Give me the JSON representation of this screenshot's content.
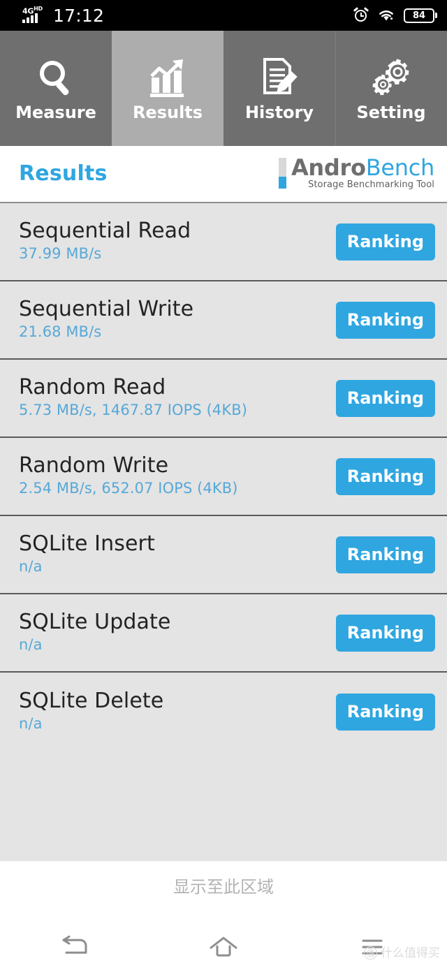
{
  "statusbar": {
    "network": "4G",
    "network_sup": "HD",
    "time": "17:12",
    "alarm_icon": "alarm-clock-icon",
    "wifi_icon": "wifi-icon",
    "battery_level": "84"
  },
  "tabs": [
    {
      "label": "Measure",
      "icon": "magnifier-icon",
      "active": false
    },
    {
      "label": "Results",
      "icon": "bar-chart-trend-icon",
      "active": true
    },
    {
      "label": "History",
      "icon": "document-pencil-icon",
      "active": false
    },
    {
      "label": "Setting",
      "icon": "gears-icon",
      "active": false
    }
  ],
  "header": {
    "page_title": "Results",
    "logo_name_part1": "Andro",
    "logo_name_part2": "Bench",
    "logo_tagline": "Storage Benchmarking Tool"
  },
  "results": [
    {
      "name": "Sequential Read",
      "value": "37.99 MB/s",
      "button": "Ranking"
    },
    {
      "name": "Sequential Write",
      "value": "21.68 MB/s",
      "button": "Ranking"
    },
    {
      "name": "Random Read",
      "value": "5.73 MB/s, 1467.87 IOPS (4KB)",
      "button": "Ranking"
    },
    {
      "name": "Random Write",
      "value": "2.54 MB/s, 652.07 IOPS (4KB)",
      "button": "Ranking"
    },
    {
      "name": "SQLite Insert",
      "value": "n/a",
      "button": "Ranking"
    },
    {
      "name": "SQLite Update",
      "value": "n/a",
      "button": "Ranking"
    },
    {
      "name": "SQLite Delete",
      "value": "n/a",
      "button": "Ranking"
    }
  ],
  "bottom": {
    "hint_text": "显示至此区域",
    "nav": [
      {
        "icon": "back-arrow-icon"
      },
      {
        "icon": "home-icon"
      },
      {
        "icon": "menu-icon"
      }
    ],
    "watermark_badge": "值",
    "watermark_text": "什么值得买"
  },
  "colors": {
    "accent_blue": "#2fa6e0",
    "value_blue": "#56a8d8",
    "tab_inactive": "#6f6f6f",
    "tab_active": "#adadad",
    "list_bg": "#e4e4e4"
  }
}
